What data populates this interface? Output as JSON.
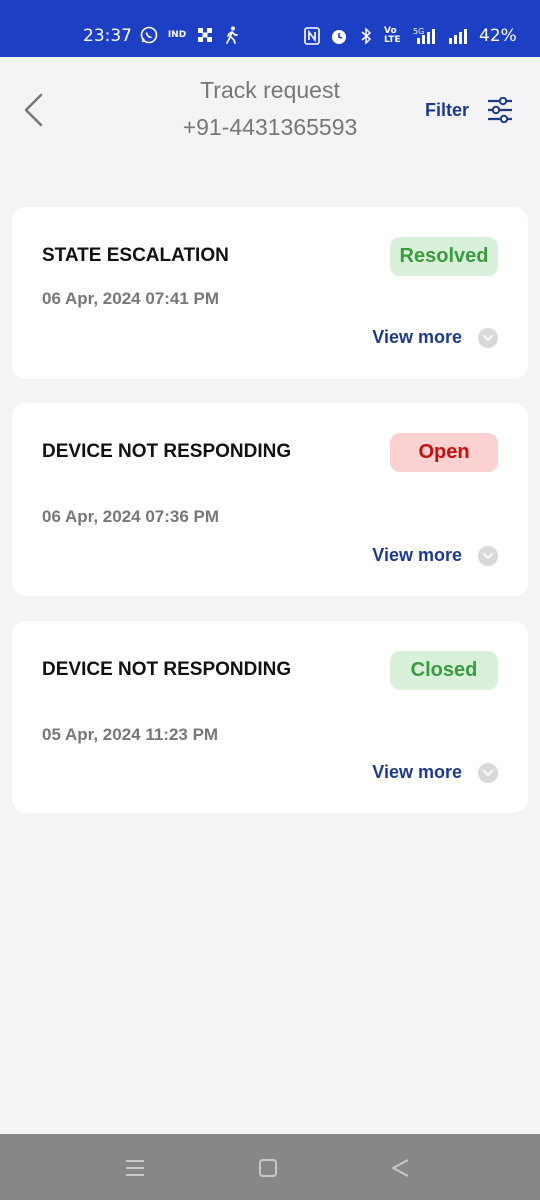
{
  "status_bar": {
    "time": "23:37",
    "left_icons": [
      "whatsapp-icon",
      "ind-icon",
      "grid-icon",
      "walking-icon"
    ],
    "right_icons": [
      "nfc-icon",
      "alarm-icon",
      "bluetooth-icon",
      "volte-icon",
      "5g-signal-icon",
      "signal-icon"
    ],
    "volte_text": "Vo LTE",
    "battery": "42%"
  },
  "header": {
    "title": "Track request",
    "subtitle": "+91-4431365593",
    "filter_label": "Filter"
  },
  "requests": [
    {
      "title": "STATE ESCALATION",
      "status": "Resolved",
      "status_color": "#3c9a3f",
      "status_bg": "#d9f0da",
      "date": "06 Apr, 2024 07:41 PM",
      "action": "View more"
    },
    {
      "title": "DEVICE NOT RESPONDING",
      "status": "Open",
      "status_color": "#c70f10",
      "status_bg": "#fbd1d1",
      "date": "06 Apr, 2024 07:36 PM",
      "action": "View more"
    },
    {
      "title": "DEVICE NOT RESPONDING",
      "status": "Closed",
      "status_color": "#3c9a3f",
      "status_bg": "#d9f0da",
      "date": "05 Apr, 2024 11:23 PM",
      "action": "View more"
    }
  ],
  "nav_bar": {
    "buttons": [
      "menu-icon",
      "home-icon",
      "back-triangle-icon"
    ]
  },
  "colors": {
    "status_bar": "#1c3fc4",
    "accent_text": "#1e3a8a",
    "background": "#f4f4f6"
  }
}
